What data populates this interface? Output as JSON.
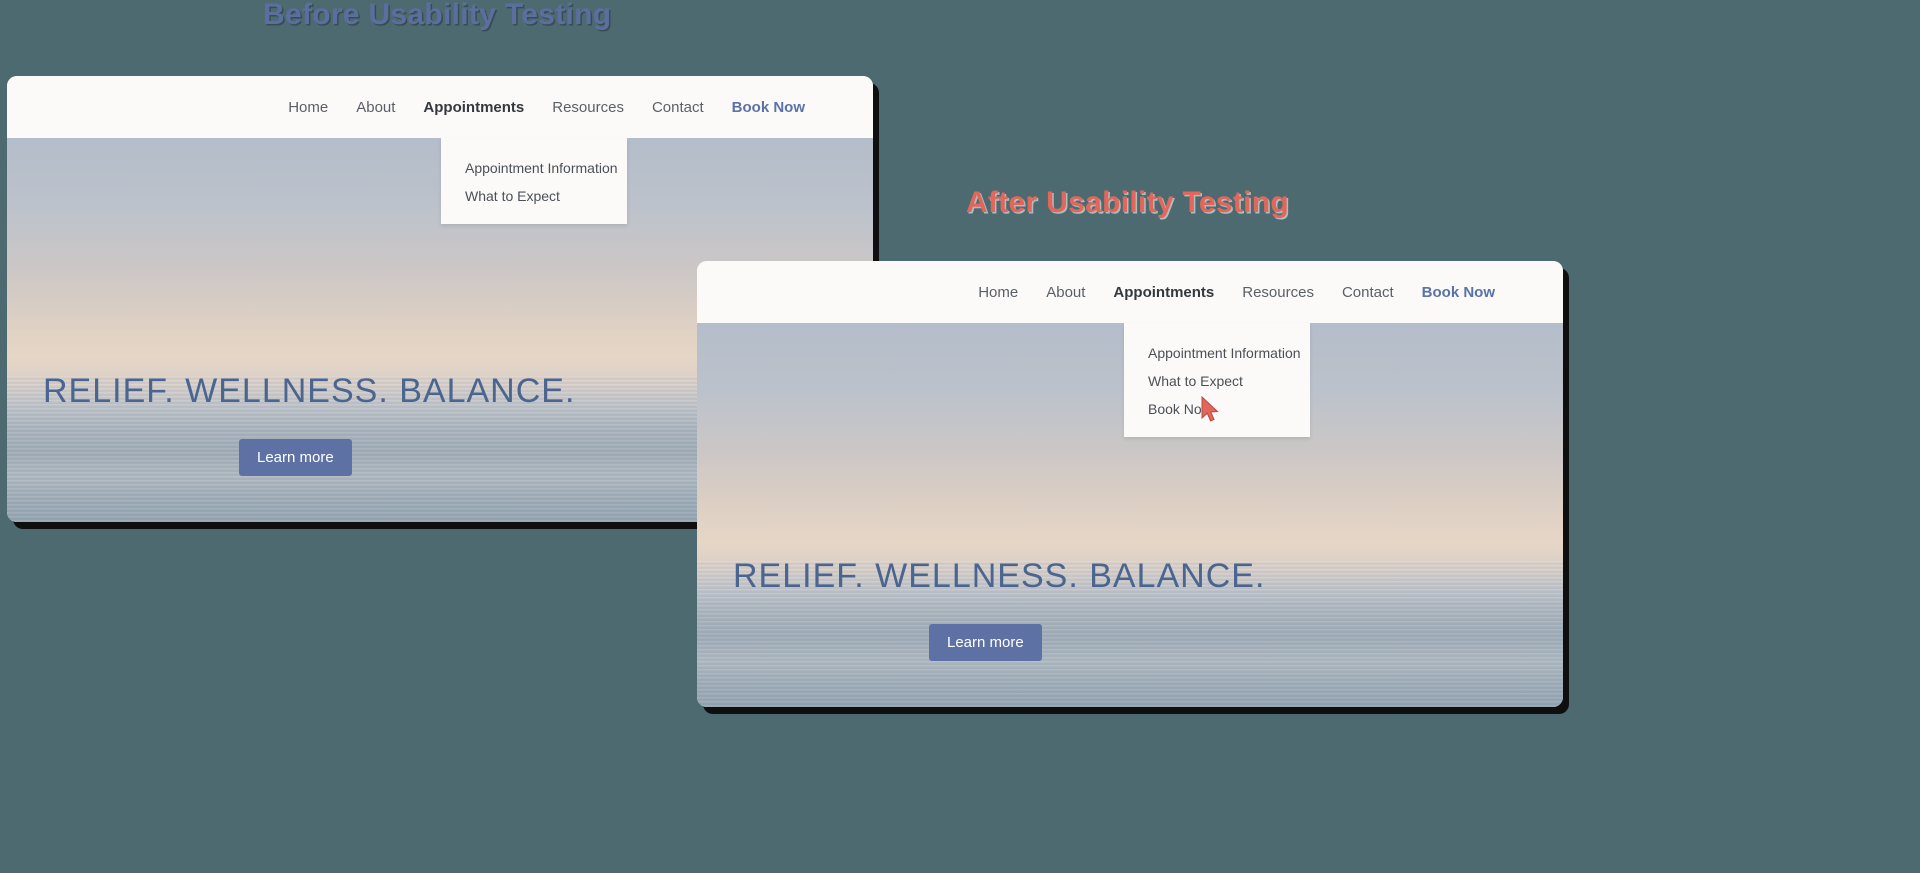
{
  "captions": {
    "before": "Before Usability Testing",
    "after": "After Usability Testing"
  },
  "colors": {
    "page_background": "#4d6a70",
    "caption_before": "#5a6f9e",
    "caption_after": "#e2675a",
    "nav_background": "#fbfaf8",
    "nav_link": "#5b6068",
    "nav_active": "#34383f",
    "nav_cta": "#5a72a8",
    "hero_title": "#4a658f",
    "button_background": "#5d71a4",
    "button_text": "#ffffff",
    "cursor": "#e2675a"
  },
  "before": {
    "nav": [
      {
        "label": "Home",
        "state": "normal"
      },
      {
        "label": "About",
        "state": "normal"
      },
      {
        "label": "Appointments",
        "state": "active"
      },
      {
        "label": "Resources",
        "state": "normal"
      },
      {
        "label": "Contact",
        "state": "normal"
      },
      {
        "label": "Book Now",
        "state": "cta"
      }
    ],
    "dropdown": {
      "items": [
        "Appointment Information",
        "What to Expect"
      ]
    },
    "hero": {
      "title": "RELIEF. WELLNESS. BALANCE.",
      "button_label": "Learn more"
    }
  },
  "after": {
    "nav": [
      {
        "label": "Home",
        "state": "normal"
      },
      {
        "label": "About",
        "state": "normal"
      },
      {
        "label": "Appointments",
        "state": "active"
      },
      {
        "label": "Resources",
        "state": "normal"
      },
      {
        "label": "Contact",
        "state": "normal"
      },
      {
        "label": "Book Now",
        "state": "cta"
      }
    ],
    "dropdown": {
      "items": [
        "Appointment Information",
        "What to Expect",
        "Book Now"
      ]
    },
    "hero": {
      "title": "RELIEF. WELLNESS. BALANCE.",
      "button_label": "Learn more"
    }
  }
}
